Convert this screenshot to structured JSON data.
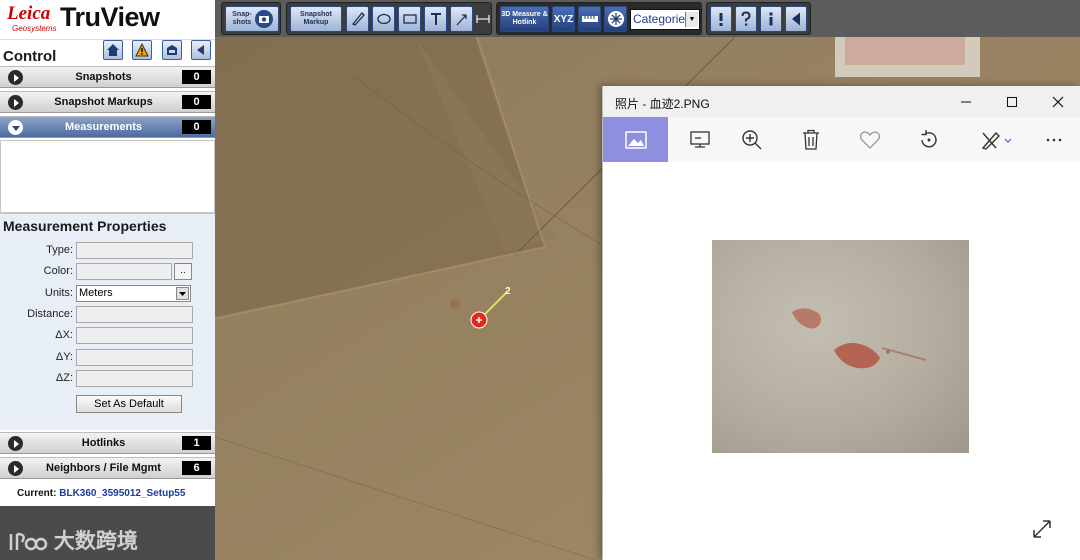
{
  "logo": {
    "brand": "Leica",
    "brand_sub": "Geosystems",
    "product": "TruView"
  },
  "control": {
    "title": "Control",
    "icons": [
      "home-icon",
      "warning-icon",
      "save-icon",
      "collapse-left-icon"
    ]
  },
  "sections": {
    "snapshots": {
      "label": "Snapshots",
      "count": "0"
    },
    "snapshot_markups": {
      "label": "Snapshot Markups",
      "count": "0"
    },
    "measurements": {
      "label": "Measurements",
      "count": "0"
    },
    "hotlinks": {
      "label": "Hotlinks",
      "count": "1"
    },
    "neighbors": {
      "label": "Neighbors / File Mgmt",
      "count": "6"
    }
  },
  "measurement_properties": {
    "title": "Measurement Properties",
    "type_label": "Type:",
    "color_label": "Color:",
    "color_button": "..",
    "units_label": "Units:",
    "units_value": "Meters",
    "distance_label": "Distance:",
    "dx_label": "ΔX:",
    "dy_label": "ΔY:",
    "dz_label": "ΔZ:",
    "set_default": "Set As Default"
  },
  "current": {
    "label": "Current:",
    "value": "BLK360_3595012_Setup55"
  },
  "watermark": "大数跨境",
  "toolbar": {
    "snapshots_btn": "Snap-shots",
    "snapshot_markup_btn": "Snapshot Markup",
    "measure_hotlink_btn": "3D Measure & Hotlink",
    "xyz_btn": "XYZ",
    "category_value": "Categorie",
    "icons": [
      "camera-icon",
      "pen-icon",
      "ellipse-icon",
      "rectangle-icon",
      "text-icon",
      "leader-icon",
      "dimension-icon",
      "ruler-icon",
      "snowflake-icon",
      "alert-icon",
      "help-icon",
      "info-icon",
      "collapse-icon"
    ]
  },
  "viewport": {
    "marker_label": "2"
  },
  "photos": {
    "title": "照片 - 血迹2.PNG",
    "window_controls": [
      "minimize-icon",
      "maximize-icon",
      "close-icon"
    ],
    "tools": [
      "image-icon",
      "slideshow-icon",
      "zoom-in-icon",
      "delete-icon",
      "favorite-icon",
      "rotate-icon",
      "edit-icon",
      "more-icon"
    ]
  }
}
